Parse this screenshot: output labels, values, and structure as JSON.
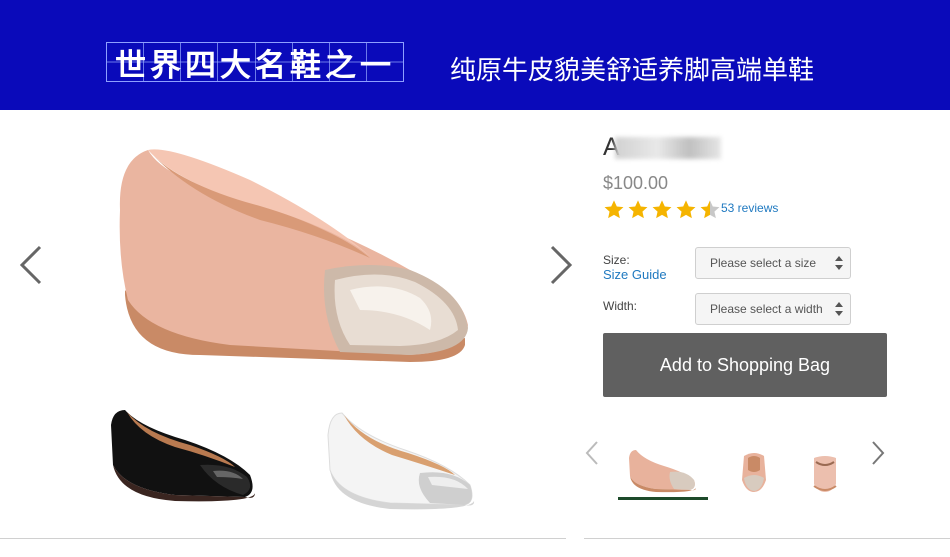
{
  "banner": {
    "title_left": "世界四大名鞋之一",
    "title_right": "纯原牛皮貌美舒适养脚高端单鞋",
    "background": "#0a0aba"
  },
  "gallery": {
    "prev_icon": "chevron-left-icon",
    "next_icon": "chevron-right-icon",
    "main_image": "blush-leather-ballet-flat-metallic-toe",
    "thumbnails": [
      "black-patent-ballet-flat",
      "white-leather-ballet-flat-silver-toe"
    ]
  },
  "product": {
    "name": "A",
    "price": "$100.00",
    "rating_stars": 4.5,
    "reviews_label": "53 reviews",
    "size_label": "Size:",
    "size_guide_label": "Size Guide",
    "size_placeholder": "Please select a size",
    "width_label": "Width:",
    "width_placeholder": "Please select a width",
    "add_to_bag_label": "Add to Shopping Bag",
    "star_color": "#f5b400",
    "link_color": "#1f79c0",
    "button_color": "#606060"
  },
  "view_thumbs": {
    "items": [
      "side-view",
      "front-view",
      "heel-view"
    ],
    "active_index": 0
  }
}
